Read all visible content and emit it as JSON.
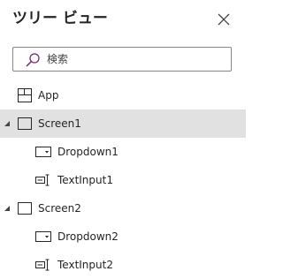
{
  "header": {
    "title": "ツリー ビュー"
  },
  "search": {
    "placeholder": "検索",
    "value": ""
  },
  "tree": {
    "app": {
      "label": "App",
      "icon": "app-icon"
    },
    "screens": [
      {
        "label": "Screen1",
        "icon": "screen-icon",
        "expanded": true,
        "selected": true,
        "children": [
          {
            "label": "Dropdown1",
            "icon": "dropdown-icon"
          },
          {
            "label": "TextInput1",
            "icon": "text-input-icon"
          }
        ]
      },
      {
        "label": "Screen2",
        "icon": "screen-icon",
        "expanded": true,
        "selected": false,
        "children": [
          {
            "label": "Dropdown2",
            "icon": "dropdown-icon"
          },
          {
            "label": "TextInput2",
            "icon": "text-input-icon"
          }
        ]
      }
    ]
  },
  "colors": {
    "selected_row": "#e1e1e1",
    "text": "#252525",
    "search_icon": "#742774",
    "border": "#8a8886"
  }
}
